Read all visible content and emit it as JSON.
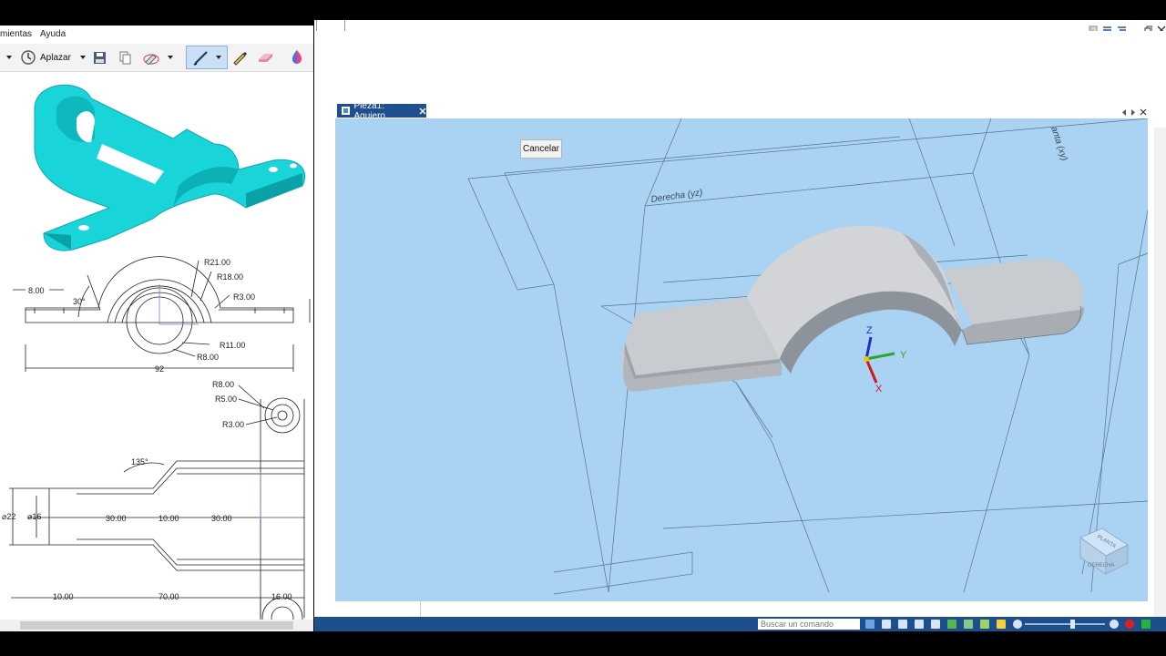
{
  "left_window": {
    "menu": [
      "mientas",
      "Ayuda"
    ],
    "toolbar": {
      "postpone_label": "Aplazar"
    },
    "drawing": {
      "section_labels": [
        "R21.00",
        "R18.00",
        "R3.00",
        "8.00",
        "30°",
        "R11.00",
        "R8.00",
        "92"
      ],
      "plan_labels": [
        "R8.00",
        "R5.00",
        "R3.00",
        "135°",
        "⌀22",
        "⌀16",
        "30.00",
        "10.00",
        "30.00",
        "10.00",
        "70.00",
        "16.00"
      ]
    }
  },
  "document": {
    "tab_title": "Pieza1: Agujero"
  },
  "viewport": {
    "cancel_label": "Cancelar",
    "plane_labels": {
      "right": "Derecha (yz)",
      "top_partial": "anta (xy)"
    },
    "axes": {
      "z": "Z",
      "y": "Y",
      "x": "X"
    },
    "viewcube": {
      "top": "PLANTA",
      "front": "DERECHA"
    }
  },
  "status_bar": {
    "command_placeholder": "Buscar un comando"
  },
  "colors": {
    "viewport_bg": "#a9d2f3",
    "status_bar": "#1c4f8c",
    "doc_tab": "#1f4f8f",
    "model_iso": "#19d4d8"
  }
}
